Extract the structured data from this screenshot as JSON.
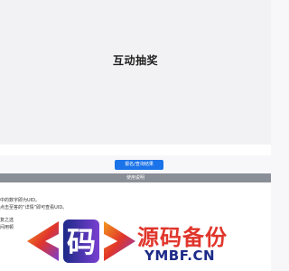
{
  "banner": {
    "title": "互动抽奖"
  },
  "actions": {
    "primary_label": "报名/查询结果"
  },
  "guide": {
    "header": "使用说明",
    "lines": [
      "中的数字即为UID。",
      "点击至答的“详情”即可查看UID。",
      "复之选",
      "间用顿"
    ]
  },
  "watermark": {
    "glyph": "码",
    "text_cn": "源码备份",
    "text_en": "YMBF.CN",
    "colors": {
      "red": "#e0352b",
      "navy": "#1c2a88",
      "purple": "#7a3fd1",
      "orange": "#f39a1e"
    }
  }
}
